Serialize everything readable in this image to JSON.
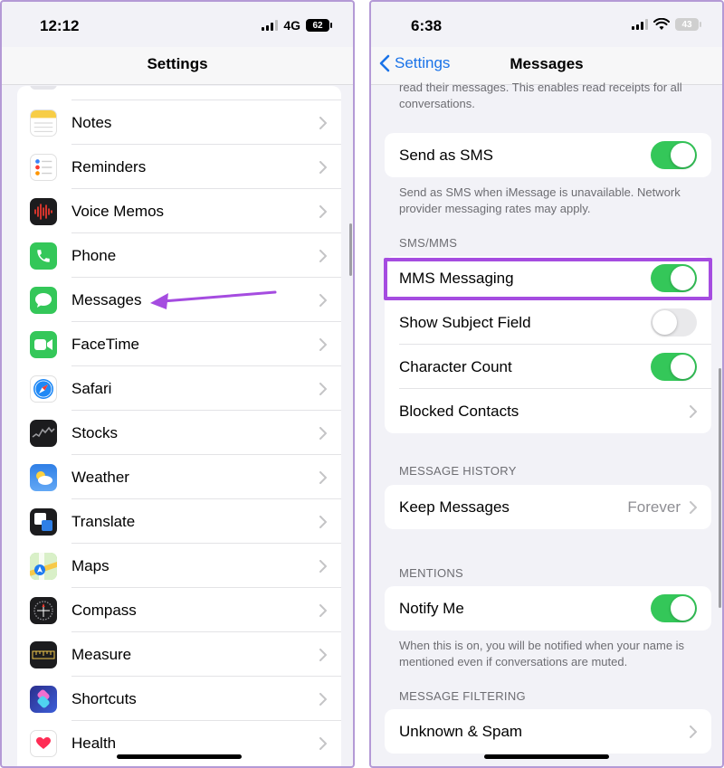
{
  "left": {
    "status": {
      "time": "12:12",
      "network": "4G",
      "battery": "62"
    },
    "nav_title": "Settings",
    "items": [
      {
        "label": "Notes",
        "icon": "notes-icon",
        "color": "#ffffff"
      },
      {
        "label": "Reminders",
        "icon": "reminders-icon",
        "color": "#ffffff"
      },
      {
        "label": "Voice Memos",
        "icon": "voice-memos-icon",
        "color": "#1c1c1e"
      },
      {
        "label": "Phone",
        "icon": "phone-icon",
        "color": "#34c759"
      },
      {
        "label": "Messages",
        "icon": "messages-icon",
        "color": "#34c759"
      },
      {
        "label": "FaceTime",
        "icon": "facetime-icon",
        "color": "#34c759"
      },
      {
        "label": "Safari",
        "icon": "safari-icon",
        "color": "#ffffff"
      },
      {
        "label": "Stocks",
        "icon": "stocks-icon",
        "color": "#1c1c1e"
      },
      {
        "label": "Weather",
        "icon": "weather-icon",
        "color": "#3b8df0"
      },
      {
        "label": "Translate",
        "icon": "translate-icon",
        "color": "#1c1c1e"
      },
      {
        "label": "Maps",
        "icon": "maps-icon",
        "color": "#7bc96f"
      },
      {
        "label": "Compass",
        "icon": "compass-icon",
        "color": "#1c1c1e"
      },
      {
        "label": "Measure",
        "icon": "measure-icon",
        "color": "#1c1c1e"
      },
      {
        "label": "Shortcuts",
        "icon": "shortcuts-icon",
        "color": "#3b3fd6"
      },
      {
        "label": "Health",
        "icon": "health-icon",
        "color": "#ffffff"
      }
    ],
    "annotation_color": "#a54ce0"
  },
  "right": {
    "status": {
      "time": "6:38",
      "battery": "43"
    },
    "nav_back": "Settings",
    "nav_title": "Messages",
    "top_note": "read their messages. This enables read receipts for all conversations.",
    "send_as_sms": {
      "label": "Send as SMS",
      "on": true
    },
    "send_as_sms_note": "Send as SMS when iMessage is unavailable. Network provider messaging rates may apply.",
    "sms_mms_header": "SMS/MMS",
    "mms_messaging": {
      "label": "MMS Messaging",
      "on": true
    },
    "show_subject": {
      "label": "Show Subject Field",
      "on": false
    },
    "character_count": {
      "label": "Character Count",
      "on": true
    },
    "blocked_contacts": {
      "label": "Blocked Contacts"
    },
    "history_header": "MESSAGE HISTORY",
    "keep_messages": {
      "label": "Keep Messages",
      "value": "Forever"
    },
    "mentions_header": "MENTIONS",
    "notify_me": {
      "label": "Notify Me",
      "on": true
    },
    "notify_note": "When this is on, you will be notified when your name is mentioned even if conversations are muted.",
    "filtering_header": "MESSAGE FILTERING",
    "unknown_spam": {
      "label": "Unknown & Spam"
    },
    "accent_color": "#34c759",
    "link_color": "#1a73e8",
    "highlight_color": "#a54ce0"
  }
}
